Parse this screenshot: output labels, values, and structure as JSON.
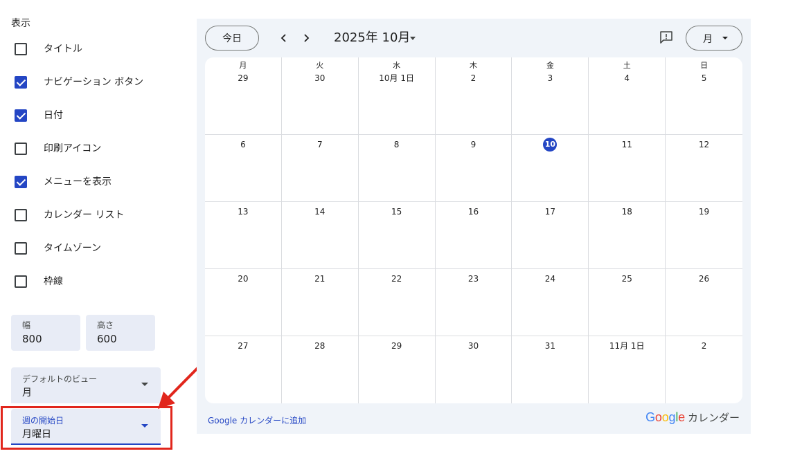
{
  "settings": {
    "section_title": "表示",
    "options": [
      {
        "label": "タイトル",
        "checked": false
      },
      {
        "label": "ナビゲーション ボタン",
        "checked": true
      },
      {
        "label": "日付",
        "checked": true
      },
      {
        "label": "印刷アイコン",
        "checked": false
      },
      {
        "label": "メニューを表示",
        "checked": true
      },
      {
        "label": "カレンダー リスト",
        "checked": false
      },
      {
        "label": "タイムゾーン",
        "checked": false
      },
      {
        "label": "枠線",
        "checked": false
      }
    ],
    "width": {
      "label": "幅",
      "value": "800"
    },
    "height": {
      "label": "高さ",
      "value": "600"
    },
    "default_view": {
      "label": "デフォルトのビュー",
      "value": "月"
    },
    "week_start": {
      "label": "週の開始日",
      "value": "月曜日"
    }
  },
  "calendar": {
    "today_label": "今日",
    "prev_icon": "chevron-left-icon",
    "next_icon": "chevron-right-icon",
    "title": "2025年 10月",
    "view_label": "月",
    "weekdays": [
      "月",
      "火",
      "水",
      "木",
      "金",
      "土",
      "日"
    ],
    "weeks": [
      [
        "29",
        "30",
        "10月 1日",
        "2",
        "3",
        "4",
        "5"
      ],
      [
        "6",
        "7",
        "8",
        "9",
        "10",
        "11",
        "12"
      ],
      [
        "13",
        "14",
        "15",
        "16",
        "17",
        "18",
        "19"
      ],
      [
        "20",
        "21",
        "22",
        "23",
        "24",
        "25",
        "26"
      ],
      [
        "27",
        "28",
        "29",
        "30",
        "31",
        "11月 1日",
        "2"
      ]
    ],
    "today": "10",
    "footer_link": "Google カレンダーに追加",
    "brand_letters": [
      "G",
      "o",
      "o",
      "g",
      "l",
      "e"
    ],
    "brand_suffix": "カレンダー"
  },
  "colors": {
    "accent": "#2446c4",
    "annotation": "#e1261c",
    "frame_bg": "#f0f4f9",
    "google_blue": "#4285f4",
    "google_red": "#ea4335",
    "google_yellow": "#fbbc05",
    "google_green": "#34a853"
  }
}
